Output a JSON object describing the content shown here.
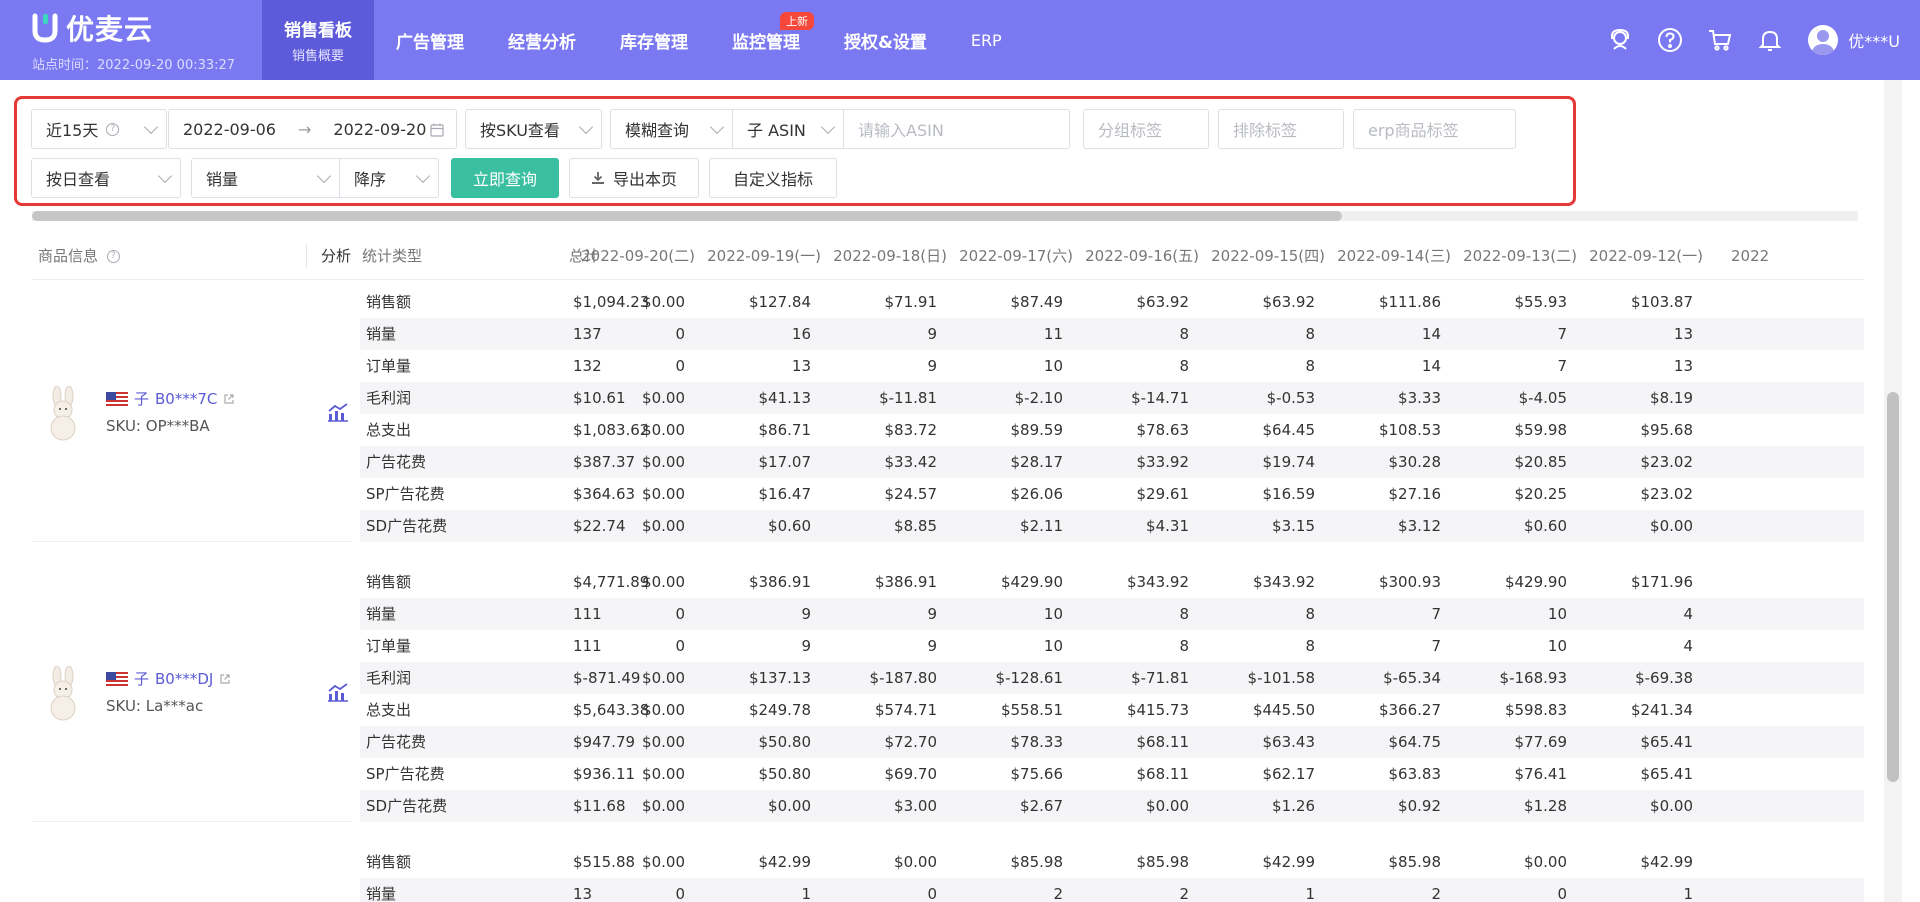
{
  "brand": {
    "name": "优麦云",
    "site_time": "站点时间：2022-09-20 00:33:27"
  },
  "nav": [
    {
      "label": "销售看板",
      "sub": "销售概要",
      "active": true
    },
    {
      "label": "广告管理"
    },
    {
      "label": "经营分析"
    },
    {
      "label": "库存管理"
    },
    {
      "label": "监控管理",
      "badge": "上新"
    },
    {
      "label": "授权&设置"
    },
    {
      "label": "ERP"
    }
  ],
  "user": {
    "name": "优***U"
  },
  "filters": {
    "range": "近15天",
    "date_start": "2022-09-06",
    "date_arrow": "→",
    "date_end": "2022-09-20",
    "view_by": "按SKU查看",
    "match": "模糊查询",
    "asin_type": "子 ASIN",
    "asin_placeholder": "请输入ASIN",
    "group_tag_placeholder": "分组标签",
    "exclude_tag_placeholder": "排除标签",
    "erp_tag_placeholder": "erp商品标签",
    "granularity": "按日查看",
    "metric": "销量",
    "order": "降序",
    "query_button": "立即查询",
    "export_button": "导出本页",
    "custom_button": "自定义指标"
  },
  "table": {
    "headers": {
      "product": "商品信息",
      "analysis": "分析",
      "stat_type": "统计类型",
      "total": "总计"
    },
    "dates": [
      "2022-09-20(二)",
      "2022-09-19(一)",
      "2022-09-18(日)",
      "2022-09-17(六)",
      "2022-09-16(五)",
      "2022-09-15(四)",
      "2022-09-14(三)",
      "2022-09-13(二)",
      "2022-09-12(一)",
      "2022"
    ],
    "products": [
      {
        "country_prefix": "子",
        "asin": "B0***7C",
        "sku": "SKU: OP***BA",
        "rows": [
          {
            "type": "销售额",
            "total": "$1,094.23",
            "values": [
              "$0.00",
              "$127.84",
              "$71.91",
              "$87.49",
              "$63.92",
              "$63.92",
              "$111.86",
              "$55.93",
              "$103.87"
            ]
          },
          {
            "type": "销量",
            "total": "137",
            "values": [
              "0",
              "16",
              "9",
              "11",
              "8",
              "8",
              "14",
              "7",
              "13"
            ]
          },
          {
            "type": "订单量",
            "total": "132",
            "values": [
              "0",
              "13",
              "9",
              "10",
              "8",
              "8",
              "14",
              "7",
              "13"
            ]
          },
          {
            "type": "毛利润",
            "total": "$10.61",
            "values": [
              "$0.00",
              "$41.13",
              "$-11.81",
              "$-2.10",
              "$-14.71",
              "$-0.53",
              "$3.33",
              "$-4.05",
              "$8.19"
            ]
          },
          {
            "type": "总支出",
            "total": "$1,083.62",
            "values": [
              "$0.00",
              "$86.71",
              "$83.72",
              "$89.59",
              "$78.63",
              "$64.45",
              "$108.53",
              "$59.98",
              "$95.68"
            ]
          },
          {
            "type": "广告花费",
            "total": "$387.37",
            "values": [
              "$0.00",
              "$17.07",
              "$33.42",
              "$28.17",
              "$33.92",
              "$19.74",
              "$30.28",
              "$20.85",
              "$23.02"
            ]
          },
          {
            "type": "SP广告花费",
            "total": "$364.63",
            "values": [
              "$0.00",
              "$16.47",
              "$24.57",
              "$26.06",
              "$29.61",
              "$16.59",
              "$27.16",
              "$20.25",
              "$23.02"
            ]
          },
          {
            "type": "SD广告花费",
            "total": "$22.74",
            "values": [
              "$0.00",
              "$0.60",
              "$8.85",
              "$2.11",
              "$4.31",
              "$3.15",
              "$3.12",
              "$0.60",
              "$0.00"
            ]
          }
        ]
      },
      {
        "country_prefix": "子",
        "asin": "B0***DJ",
        "sku": "SKU: La***ac",
        "rows": [
          {
            "type": "销售额",
            "total": "$4,771.89",
            "values": [
              "$0.00",
              "$386.91",
              "$386.91",
              "$429.90",
              "$343.92",
              "$343.92",
              "$300.93",
              "$429.90",
              "$171.96"
            ]
          },
          {
            "type": "销量",
            "total": "111",
            "values": [
              "0",
              "9",
              "9",
              "10",
              "8",
              "8",
              "7",
              "10",
              "4"
            ]
          },
          {
            "type": "订单量",
            "total": "111",
            "values": [
              "0",
              "9",
              "9",
              "10",
              "8",
              "8",
              "7",
              "10",
              "4"
            ]
          },
          {
            "type": "毛利润",
            "total": "$-871.49",
            "values": [
              "$0.00",
              "$137.13",
              "$-187.80",
              "$-128.61",
              "$-71.81",
              "$-101.58",
              "$-65.34",
              "$-168.93",
              "$-69.38"
            ]
          },
          {
            "type": "总支出",
            "total": "$5,643.38",
            "values": [
              "$0.00",
              "$249.78",
              "$574.71",
              "$558.51",
              "$415.73",
              "$445.50",
              "$366.27",
              "$598.83",
              "$241.34"
            ]
          },
          {
            "type": "广告花费",
            "total": "$947.79",
            "values": [
              "$0.00",
              "$50.80",
              "$72.70",
              "$78.33",
              "$68.11",
              "$63.43",
              "$64.75",
              "$77.69",
              "$65.41"
            ]
          },
          {
            "type": "SP广告花费",
            "total": "$936.11",
            "values": [
              "$0.00",
              "$50.80",
              "$69.70",
              "$75.66",
              "$68.11",
              "$62.17",
              "$63.83",
              "$76.41",
              "$65.41"
            ]
          },
          {
            "type": "SD广告花费",
            "total": "$11.68",
            "values": [
              "$0.00",
              "$0.00",
              "$3.00",
              "$2.67",
              "$0.00",
              "$1.26",
              "$0.92",
              "$1.28",
              "$0.00"
            ]
          }
        ]
      },
      {
        "country_prefix": "",
        "asin": "",
        "sku": "",
        "rows": [
          {
            "type": "销售额",
            "total": "$515.88",
            "values": [
              "$0.00",
              "$42.99",
              "$0.00",
              "$85.98",
              "$85.98",
              "$42.99",
              "$85.98",
              "$0.00",
              "$42.99"
            ]
          },
          {
            "type": "销量",
            "total": "13",
            "values": [
              "0",
              "1",
              "0",
              "2",
              "2",
              "1",
              "2",
              "0",
              "1"
            ]
          }
        ]
      }
    ]
  },
  "icons": {
    "brand_logo": "brand-logo-icon",
    "support": "support-icon",
    "help": "help-icon",
    "cart": "cart-icon",
    "bell": "bell-icon",
    "calendar": "calendar-icon",
    "download": "download-icon",
    "analysis": "trend-chart-icon",
    "flag": "us-flag-icon",
    "external": "external-link-icon"
  },
  "colors": {
    "nav_bg": "#7b79f2",
    "nav_active": "#5d5bd9",
    "primary": "#3bbfa1",
    "highlight_border": "#e53935",
    "link": "#5b5bd6",
    "badge": "#f5483b"
  }
}
